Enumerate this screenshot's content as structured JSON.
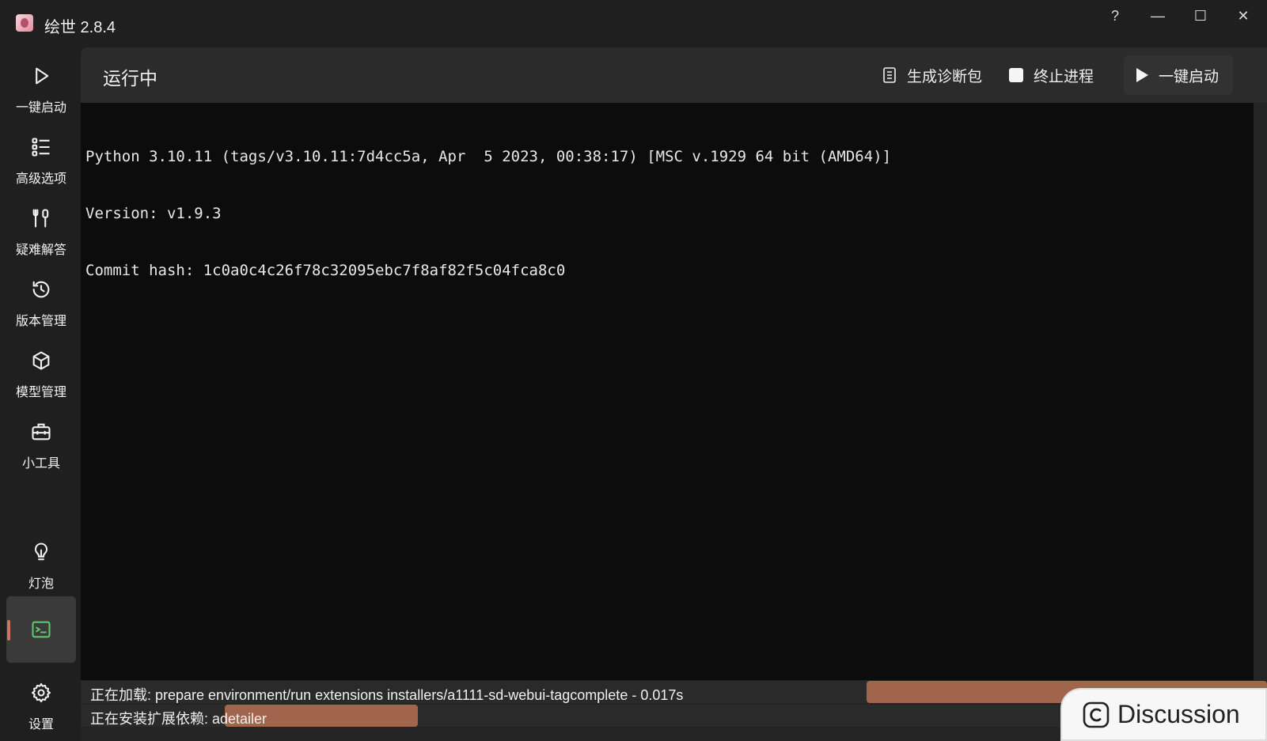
{
  "app": {
    "title": "绘世 2.8.4"
  },
  "window_controls": {
    "help": "?",
    "minimize": "—",
    "maximize": "☐",
    "close": "✕"
  },
  "sidebar": {
    "items": [
      {
        "label": "一键启动",
        "icon": "play-icon"
      },
      {
        "label": "高级选项",
        "icon": "list-icon"
      },
      {
        "label": "疑难解答",
        "icon": "tools-icon"
      },
      {
        "label": "版本管理",
        "icon": "history-icon"
      },
      {
        "label": "模型管理",
        "icon": "cube-icon"
      },
      {
        "label": "小工具",
        "icon": "toolbox-icon"
      },
      {
        "label": "灯泡",
        "icon": "lightbulb-icon"
      },
      {
        "label": "",
        "icon": "terminal-icon",
        "active": true
      },
      {
        "label": "设置",
        "icon": "gear-icon"
      }
    ],
    "accent_color": "#c8785a",
    "terminal_icon_color": "#5cc76b"
  },
  "header": {
    "title": "运行中",
    "diagnostic_label": "生成诊断包",
    "stop_label": "终止进程",
    "launch_label": "一键启动"
  },
  "console": {
    "lines": [
      "Python 3.10.11 (tags/v3.10.11:7d4cc5a, Apr  5 2023, 00:38:17) [MSC v.1929 64 bit (AMD64)]",
      "Version: v1.9.3",
      "Commit hash: 1c0a0c4c26f78c32095ebc7f8af82f5c04fca8c0"
    ]
  },
  "status": {
    "loading_text": "正在加载: prepare environment/run extensions installers/a1111-sd-webui-tagcomplete - 0.017s",
    "installing_text": "正在安装扩展依赖: adetailer",
    "bar_color": "#a0654c"
  },
  "discussion": {
    "label": "Discussion",
    "icon": "copyright-c-icon"
  }
}
